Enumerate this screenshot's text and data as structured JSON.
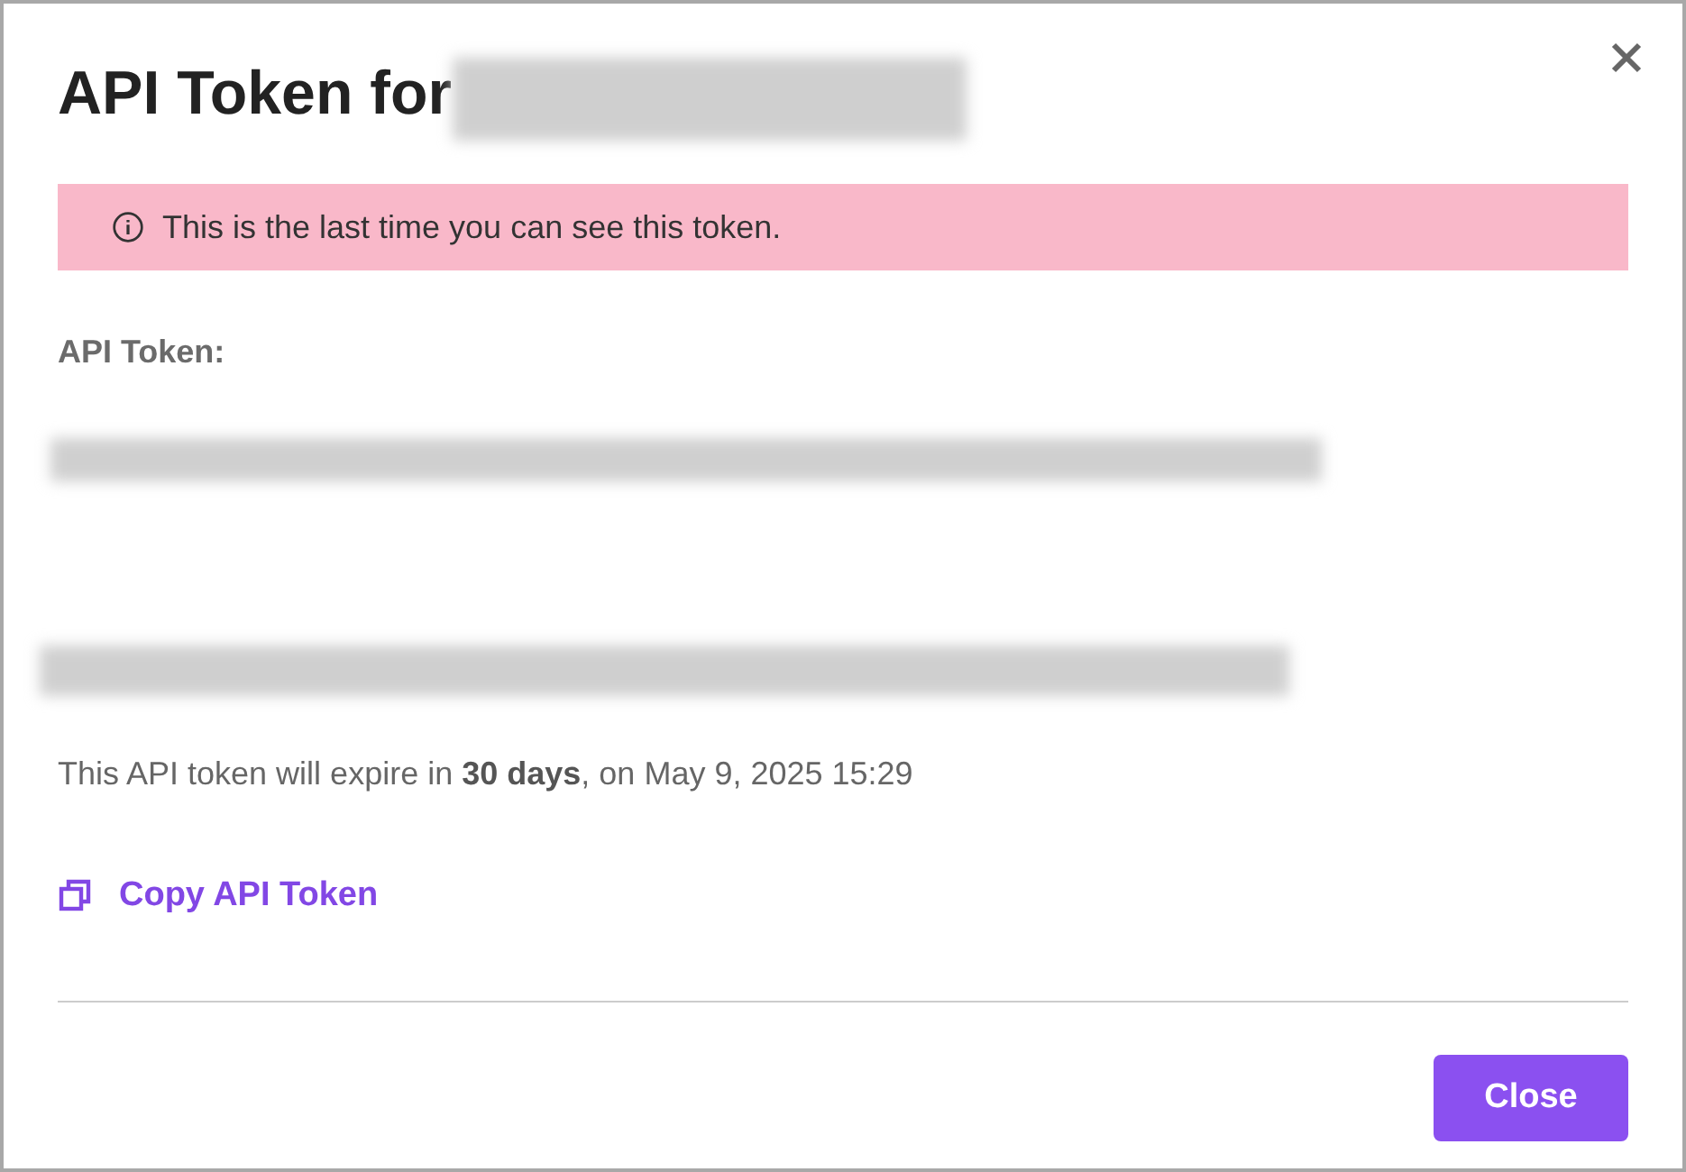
{
  "dialog": {
    "title": "API Token for",
    "alert": "This is the last time you can see this token.",
    "token_label": "API Token:",
    "expiry_note": "This API token will expire in **30 days**, on May 9, 2025 15:29",
    "copy_link": "Copy API Token",
    "close_button": "Close"
  }
}
